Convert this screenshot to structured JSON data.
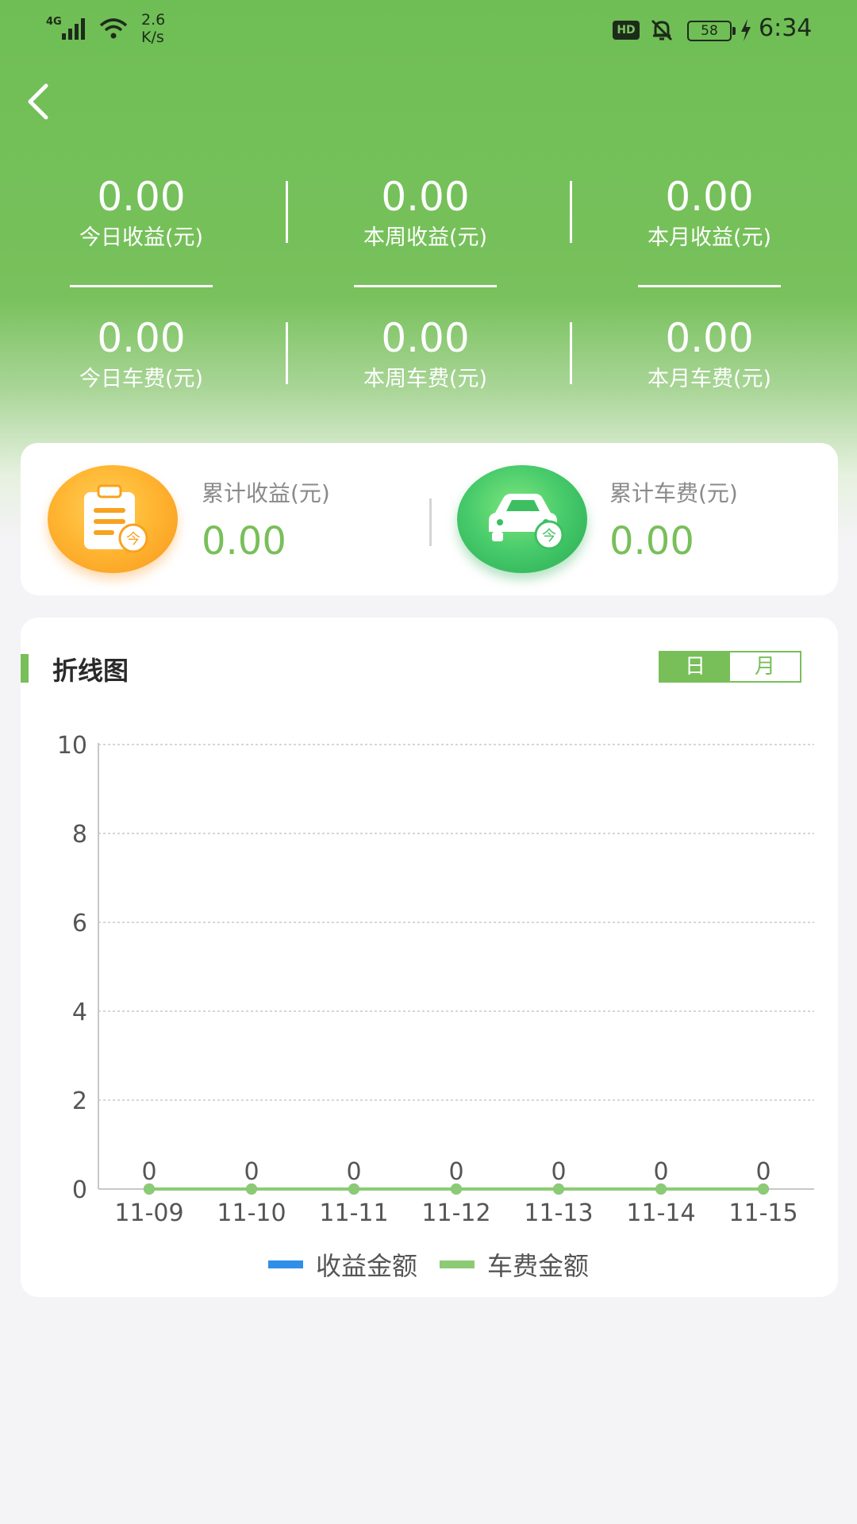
{
  "status_bar": {
    "network": "4G",
    "speed_value": "2.6",
    "speed_unit": "K/s",
    "hd": "HD",
    "battery": "58",
    "time": "6:34"
  },
  "stats": {
    "row1": [
      {
        "value": "0.00",
        "label": "今日收益(元)"
      },
      {
        "value": "0.00",
        "label": "本周收益(元)"
      },
      {
        "value": "0.00",
        "label": "本月收益(元)"
      }
    ],
    "row2": [
      {
        "value": "0.00",
        "label": "今日车费(元)"
      },
      {
        "value": "0.00",
        "label": "本周车费(元)"
      },
      {
        "value": "0.00",
        "label": "本月车费(元)"
      }
    ]
  },
  "totals": {
    "income": {
      "label": "累计收益(元)",
      "value": "0.00",
      "badge": "今",
      "icon": "clipboard-icon"
    },
    "fare": {
      "label": "累计车费(元)",
      "value": "0.00",
      "badge": "今",
      "icon": "car-icon"
    }
  },
  "chart_section": {
    "title": "折线图",
    "toggle": {
      "day": "日",
      "month": "月",
      "selected": "日"
    }
  },
  "colors": {
    "primary_green": "#78bf5a",
    "income_series": "#2f8fe8",
    "fare_series": "#8ccb74"
  },
  "chart_data": {
    "type": "line",
    "categories": [
      "11-09",
      "11-10",
      "11-11",
      "11-12",
      "11-13",
      "11-14",
      "11-15"
    ],
    "series": [
      {
        "name": "收益金额",
        "values": [
          0,
          0,
          0,
          0,
          0,
          0,
          0
        ]
      },
      {
        "name": "车费金额",
        "values": [
          0,
          0,
          0,
          0,
          0,
          0,
          0
        ]
      }
    ],
    "data_labels": [
      "0",
      "0",
      "0",
      "0",
      "0",
      "0",
      "0"
    ],
    "ylim": [
      0,
      10
    ],
    "yticks": [
      0,
      2,
      4,
      6,
      8,
      10
    ],
    "grid": true,
    "legend": "bottom-center"
  }
}
